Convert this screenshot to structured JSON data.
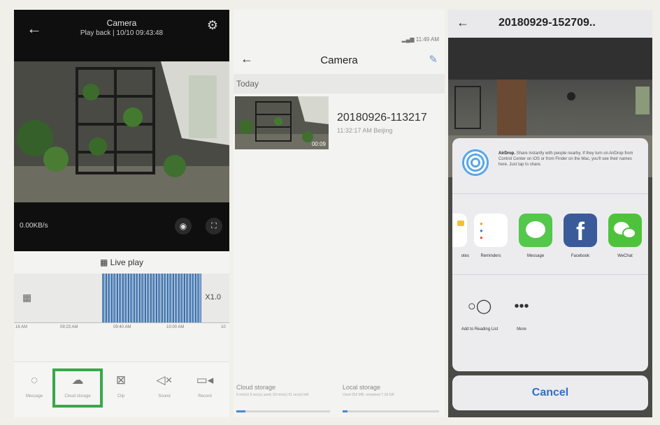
{
  "panel_playback": {
    "title": "Camera",
    "subtitle": "Play back | 10/10 09:43:48",
    "speed": "0.00KB/s",
    "live_label": "Live play",
    "zoom": "X1.0",
    "ticks": [
      "16 AM",
      "09:23 AM",
      "09:40 AM",
      "10:00 AM",
      "10"
    ],
    "toolbar": [
      "Message",
      "Cloud storage",
      "Clip",
      "Sound",
      "Record"
    ]
  },
  "panel_list": {
    "status": "11:49 AM",
    "title": "Camera",
    "section": "Today",
    "clip_name": "20180926-113217",
    "clip_time": "11:32:17 AM Beijing",
    "clip_duration": "00:09",
    "cloud_label": "Cloud storage",
    "cloud_detail": "6 min(s) 9 sec(s) used; 53 min(s) 51 sec(s) left",
    "cloud_used": 0.1,
    "local_label": "Local storage",
    "local_detail": "Used 352 MB, remained 7.19 GB",
    "local_used": 0.05
  },
  "panel_share": {
    "title": "20180929-152709..",
    "airdrop_title": "AirDrop.",
    "airdrop_text": "Share instantly with people nearby. If they turn on AirDrop from Control Center on iOS or from Finder on the Mac, you'll see their names here. Just tap to share.",
    "apps": [
      "otes",
      "Reminders",
      "Message",
      "Facebook",
      "WeChat"
    ],
    "actions": [
      "Add to Reading List",
      "More"
    ],
    "cancel": "Cancel",
    "colors": {
      "message": "#53c84a",
      "facebook": "#3b5a9a",
      "wechat": "#4fc23c",
      "accent": "#2d6fc9"
    }
  }
}
